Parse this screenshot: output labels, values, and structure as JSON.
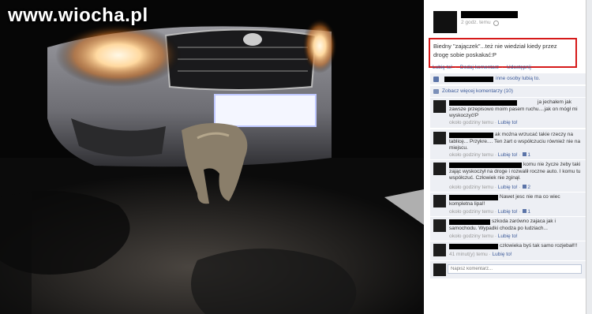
{
  "watermark": "www.wiocha.pl",
  "post": {
    "time": "2 godz. temu",
    "text": "Biedny \"zajączek\"...też nie wiedział kiedy przez drogę sobie poskakać:P",
    "actions": [
      "Lubię to!",
      "Dodaj komentarz",
      "Udostępnij"
    ],
    "likes_text": "inne osoby lubią to.",
    "more_comments": "Zobacz więcej komentarzy (10)"
  },
  "comments": [
    {
      "text": "ja jechałem jak zawsze przepisowo moim pasem ruchu....jak on mógł mi wyskoczyć!P",
      "time": "około godziny temu",
      "like": "Lubię to!",
      "count": ""
    },
    {
      "text": "ak można wrzucać takie rzeczy na tablicę... Przykre.... Ten żart o współczuciu również nie na miejscu.",
      "time": "około godziny temu",
      "like": "Lubię to!",
      "count": "1"
    },
    {
      "text": "komu nie życze żeby taki zając wyskoczył na droge i rozwalił roczne auto. I komu tu współczuć. Człowiek nie zginął.",
      "time": "około godziny temu",
      "like": "Lubię to!",
      "count": "2"
    },
    {
      "text": "Nawet jesc nie ma co wiec kompletna lipa!!",
      "time": "około godziny temu",
      "like": "Lubię to!",
      "count": "1"
    },
    {
      "text": "szkoda zarówno zajaca jak i samochodu. Wypadki chodza po ludziach...",
      "time": "około godziny temu",
      "like": "Lubię to!",
      "count": ""
    },
    {
      "text": "człowieka byś tak samo rozjebał!!!",
      "time": "41 minut(y) temu",
      "like": "Lubię to!",
      "count": ""
    }
  ],
  "composer": {
    "placeholder": "Napisz komentarz..."
  }
}
